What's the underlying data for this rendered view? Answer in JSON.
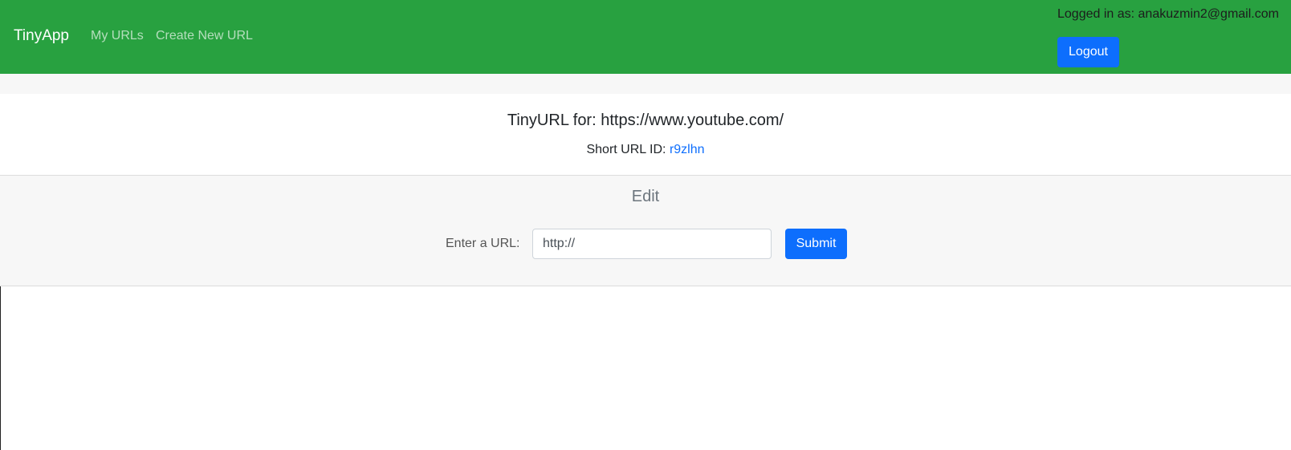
{
  "navbar": {
    "brand": "TinyApp",
    "links": {
      "my_urls": "My URLs",
      "create_new": "Create New URL"
    },
    "login_text": "Logged in as: anakuzmin2@gmail.com",
    "logout_label": "Logout"
  },
  "card": {
    "title": "TinyURL for: https://www.youtube.com/",
    "short_label": "Short URL ID:",
    "short_id": "r9zlhn"
  },
  "edit": {
    "title": "Edit",
    "input_label": "Enter a URL:",
    "input_value": "http://",
    "submit_label": "Submit"
  },
  "colors": {
    "navbar_bg": "#28a140",
    "primary": "#0d6efd",
    "footer_bg": "#f7f7f7"
  }
}
